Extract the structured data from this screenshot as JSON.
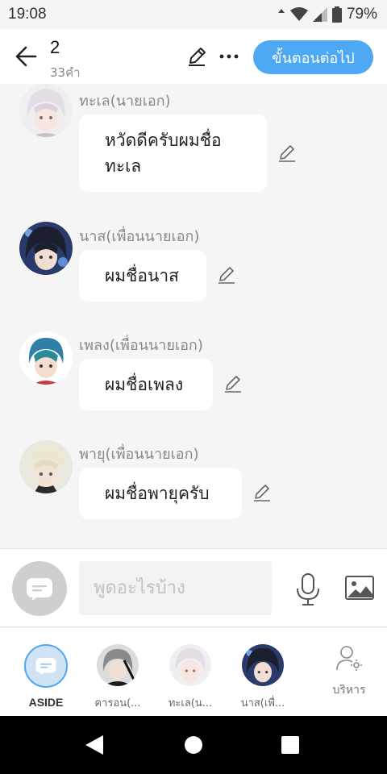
{
  "status_bar": {
    "time": "19:08",
    "battery": "79%"
  },
  "header": {
    "title": "2",
    "word_count": "33คำ",
    "next_label": "ขั้นตอนต่อไป",
    "accent": "#4fa8f3"
  },
  "messages": [
    {
      "speaker": "ทะเล(นายเอก)",
      "text_lines": [
        "หวัดดีครับผมชื่อ",
        "ทะเล"
      ],
      "avatar": "white-haired-character-avatar"
    },
    {
      "speaker": "นาส(เพื่อนนายเอก)",
      "text_lines": [
        "ผมชื่อนาส"
      ],
      "avatar": "dark-haired-character-avatar"
    },
    {
      "speaker": "เพลง(เพื่อนนายเอก)",
      "text_lines": [
        "ผมชื่อเพลง"
      ],
      "avatar": "blue-haired-character-avatar"
    },
    {
      "speaker": "พายุ(เพื่อนนายเอก)",
      "text_lines": [
        "ผมชื่อพายุครับ"
      ],
      "avatar": "blonde-character-avatar"
    }
  ],
  "composer": {
    "placeholder": "พูดอะไรบ้าง"
  },
  "characters": [
    {
      "label": "ASIDE"
    },
    {
      "label": "คารอน(..."
    },
    {
      "label": "ทะเล(น..."
    },
    {
      "label": "นาส(เพื่..."
    }
  ],
  "manage_label": "บริหาร"
}
